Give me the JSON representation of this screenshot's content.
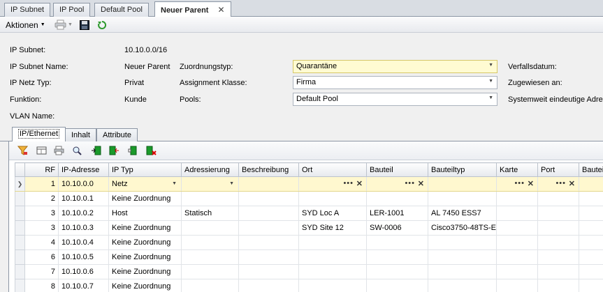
{
  "top_tabs": [
    {
      "label": "IP Subnet"
    },
    {
      "label": "IP Pool"
    },
    {
      "label": "Default Pool"
    },
    {
      "label": "Neuer Parent",
      "close": "✕"
    }
  ],
  "toolbar": {
    "actions_label": "Aktionen",
    "icons": [
      "print-icon",
      "save-icon",
      "refresh-icon"
    ]
  },
  "form": {
    "ip_subnet_label": "IP Subnet:",
    "ip_subnet_value": "10.10.0.0/16",
    "ip_subnet_name_label": "IP Subnet Name:",
    "ip_subnet_name_value": "Neuer Parent",
    "ip_netz_typ_label": "IP Netz Typ:",
    "ip_netz_typ_value": "Privat",
    "funktion_label": "Funktion:",
    "funktion_value": "Kunde",
    "vlan_name_label": "VLAN Name:",
    "zuordnungstyp_label": "Zuordnungstyp:",
    "zuordnungstyp_value": "Quarantäne",
    "assignment_klasse_label": "Assignment Klasse:",
    "assignment_klasse_value": "Firma",
    "pools_label": "Pools:",
    "pools_value": "Default Pool",
    "verfallsdatum_label": "Verfallsdatum:",
    "zugewiesen_label": "Zugewiesen an:",
    "systemweit_label": "Systemweit eindeutige Adres"
  },
  "inner_tabs": [
    {
      "label": "IP/Ethernet"
    },
    {
      "label": "Inhalt"
    },
    {
      "label": "Attribute"
    }
  ],
  "grid_toolbar_icons": [
    "filter-icon",
    "column-chooser-icon",
    "print-icon",
    "search-icon",
    "export-icon",
    "import-icon",
    "add-row-icon",
    "delete-row-icon"
  ],
  "grid": {
    "columns": [
      "RF",
      "IP-Adresse",
      "IP Typ",
      "Adressierung",
      "Beschreibung",
      "Ort",
      "Bauteil",
      "Bauteiltyp",
      "Karte",
      "Port",
      "Bauteil"
    ],
    "rows": [
      {
        "rf": "1",
        "ip": "10.10.0.0",
        "typ": "Netz",
        "adr": "",
        "desc": "",
        "ort": "",
        "bauteil": "",
        "bauteiltyp": "",
        "karte": "",
        "port": "",
        "bauteil2": ""
      },
      {
        "rf": "2",
        "ip": "10.10.0.1",
        "typ": "Keine Zuordnung",
        "adr": "",
        "desc": "",
        "ort": "",
        "bauteil": "",
        "bauteiltyp": "",
        "karte": "",
        "port": "",
        "bauteil2": ""
      },
      {
        "rf": "3",
        "ip": "10.10.0.2",
        "typ": "Host",
        "adr": "Statisch",
        "desc": "",
        "ort": "SYD Loc A",
        "bauteil": "LER-1001",
        "bauteiltyp": "AL 7450 ESS7",
        "karte": "",
        "port": "",
        "bauteil2": ""
      },
      {
        "rf": "3",
        "ip": "10.10.0.3",
        "typ": "Keine Zuordnung",
        "adr": "",
        "desc": "",
        "ort": "SYD Site 12",
        "bauteil": "SW-0006",
        "bauteiltyp": "Cisco3750-48TS-E",
        "karte": "",
        "port": "",
        "bauteil2": ""
      },
      {
        "rf": "4",
        "ip": "10.10.0.4",
        "typ": "Keine Zuordnung",
        "adr": "",
        "desc": "",
        "ort": "",
        "bauteil": "",
        "bauteiltyp": "",
        "karte": "",
        "port": "",
        "bauteil2": ""
      },
      {
        "rf": "6",
        "ip": "10.10.0.5",
        "typ": "Keine Zuordnung",
        "adr": "",
        "desc": "",
        "ort": "",
        "bauteil": "",
        "bauteiltyp": "",
        "karte": "",
        "port": "",
        "bauteil2": ""
      },
      {
        "rf": "7",
        "ip": "10.10.0.6",
        "typ": "Keine Zuordnung",
        "adr": "",
        "desc": "",
        "ort": "",
        "bauteil": "",
        "bauteiltyp": "",
        "karte": "",
        "port": "",
        "bauteil2": ""
      },
      {
        "rf": "8",
        "ip": "10.10.0.7",
        "typ": "Keine Zuordnung",
        "adr": "",
        "desc": "",
        "ort": "",
        "bauteil": "",
        "bauteiltyp": "",
        "karte": "",
        "port": "",
        "bauteil2": ""
      }
    ]
  },
  "colors": {
    "active_row": "#fff8cf",
    "required_field": "#fffbd2",
    "tab_border": "#8c96a4"
  }
}
